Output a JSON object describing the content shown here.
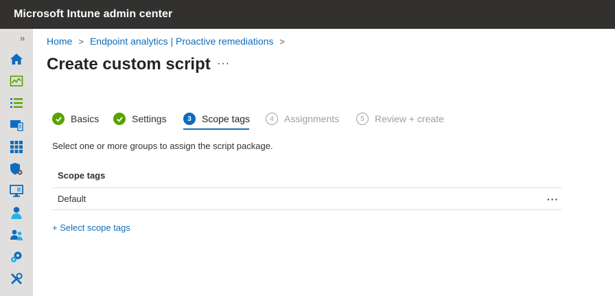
{
  "header": {
    "title": "Microsoft Intune admin center"
  },
  "leftnav": {
    "collapse_glyph": "»",
    "items": [
      {
        "icon": "home-icon"
      },
      {
        "icon": "dashboard-icon"
      },
      {
        "icon": "all-services-icon"
      },
      {
        "icon": "devices-icon"
      },
      {
        "icon": "apps-icon"
      },
      {
        "icon": "endpoint-security-icon"
      },
      {
        "icon": "reports-icon"
      },
      {
        "icon": "users-icon"
      },
      {
        "icon": "groups-icon"
      },
      {
        "icon": "tenant-admin-icon"
      },
      {
        "icon": "troubleshooting-icon"
      }
    ]
  },
  "breadcrumb": {
    "items": [
      "Home",
      "Endpoint analytics | Proactive remediations"
    ],
    "separator": ">"
  },
  "page": {
    "title": "Create custom script",
    "more": "···"
  },
  "steps": [
    {
      "label": "Basics",
      "state": "done"
    },
    {
      "label": "Settings",
      "state": "done"
    },
    {
      "label": "Scope tags",
      "state": "current",
      "number": "3"
    },
    {
      "label": "Assignments",
      "state": "todo",
      "number": "4"
    },
    {
      "label": "Review + create",
      "state": "todo",
      "number": "5"
    }
  ],
  "main": {
    "description": "Select one or more groups to assign the script package.",
    "table": {
      "header": "Scope tags",
      "rows": [
        {
          "name": "Default",
          "more": "···"
        }
      ]
    },
    "select_link": "+ Select scope tags"
  },
  "colors": {
    "accent": "#0f6cbd",
    "done": "#57a300",
    "topbar": "#323130",
    "nav": "#e1dfdd"
  }
}
